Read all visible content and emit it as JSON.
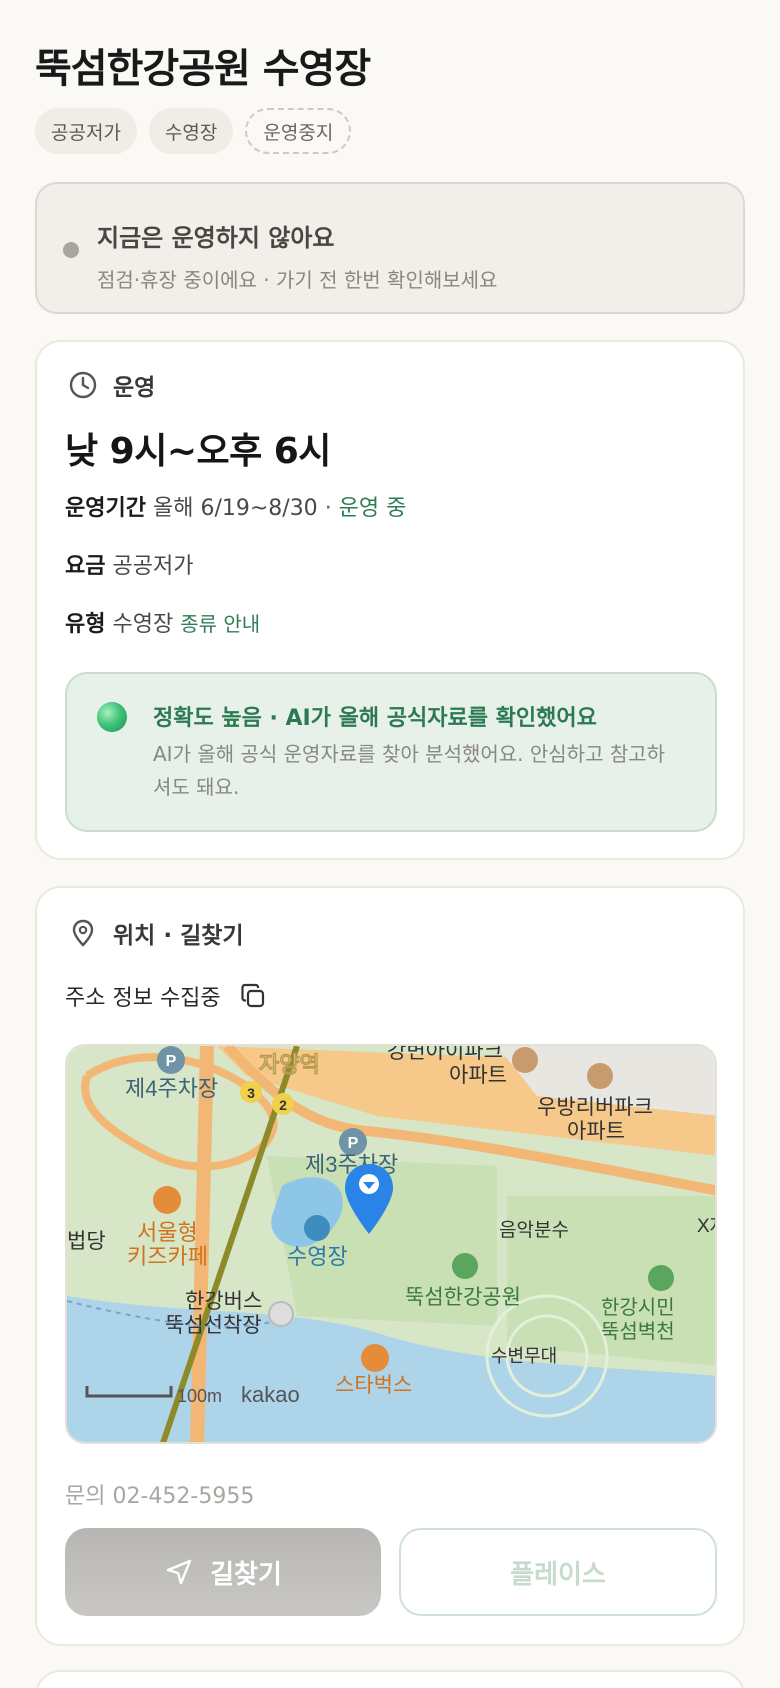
{
  "header": {
    "title": "뚝섬한강공원 수영장"
  },
  "chips": [
    "공공저가",
    "수영장",
    "운영중지"
  ],
  "notice": {
    "title": "지금은 운영하지 않아요",
    "subtitle": "점검·휴장 중이에요 · 가기 전 한번 확인해보세요"
  },
  "operation": {
    "section_label": "운영",
    "hours": "낮 9시~오후 6시",
    "period_label": "운영기간",
    "period_value": "올해 6/19~8/30",
    "period_status": "· 운영 중",
    "fee_label": "요금",
    "fee_value": "공공저가",
    "type_label": "유형",
    "type_value": "수영장",
    "type_link": "종류 안내"
  },
  "accuracy": {
    "title": "정확도 높음 · AI가 올해 공식자료를 확인했어요",
    "body": "AI가 올해 공식 운영자료를 찾아 분석했어요. 안심하고 참고하셔도 돼요."
  },
  "location": {
    "section_label": "위치 · 길찾기",
    "address": "주소 정보 수집중",
    "phone": "문의 02-452-5955",
    "route_button": "길찾기",
    "place_button": "플레이스"
  },
  "map": {
    "labels": {
      "parking4": "제4주차장",
      "station": "자양역",
      "line3": "3",
      "line2": "2",
      "apt1_a": "강변아이파크",
      "apt1_b": "아파트",
      "apt2_a": "우방리버파크",
      "apt2_b": "아파트",
      "parking3": "제3주차장",
      "cafe_a": "서울형",
      "cafe_b": "키즈카페",
      "left_edge": "법당",
      "pool": "수영장",
      "fountain": "음악분수",
      "right_edge": "X자",
      "park": "뚝섬한강공원",
      "bus_a": "한강버스",
      "bus_b": "뚝섬선착장",
      "right2_a": "한강시민",
      "right2_b": "뚝섬벽천",
      "stage": "수변무대",
      "starbucks": "스타벅스",
      "scale": "100m",
      "brand": "kakao"
    }
  }
}
